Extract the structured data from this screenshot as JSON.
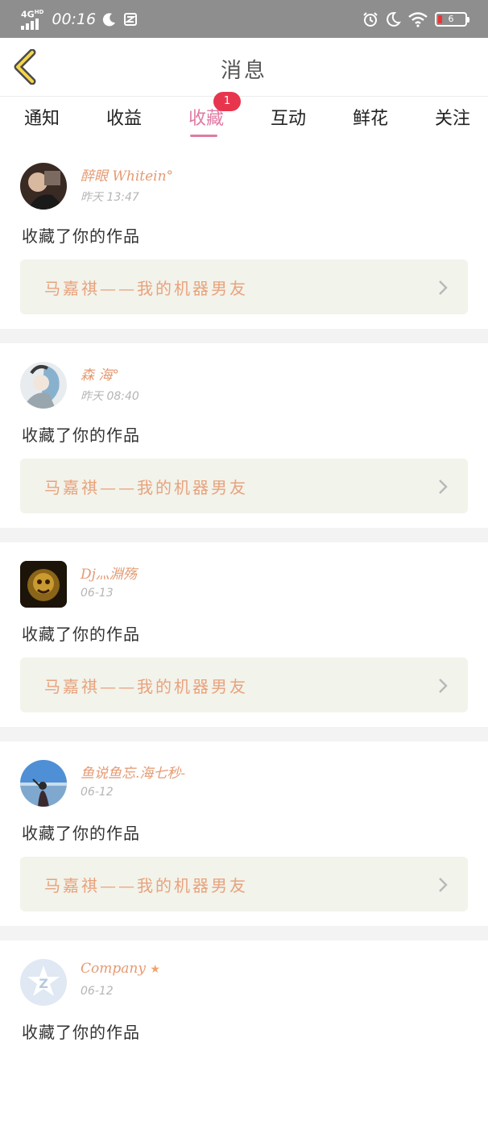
{
  "status_bar": {
    "network": "4G",
    "network_sup": "HD",
    "time": "00:16",
    "battery": "6"
  },
  "header": {
    "title": "消息"
  },
  "tabs": [
    {
      "label": "通知"
    },
    {
      "label": "收益"
    },
    {
      "label": "收藏",
      "badge": "1",
      "active": true
    },
    {
      "label": "互动"
    },
    {
      "label": "鲜花"
    },
    {
      "label": "关注"
    }
  ],
  "messages": [
    {
      "user": "醉眼 Whitein°",
      "time": "昨天 13:47",
      "action": "收藏了你的作品",
      "work": "马嘉祺——我的机器男友"
    },
    {
      "user": "森 海°",
      "time": "昨天 08:40",
      "action": "收藏了你的作品",
      "work": "马嘉祺——我的机器男友"
    },
    {
      "user": "Dj灬淵殇",
      "time": "06-13",
      "action": "收藏了你的作品",
      "work": "马嘉祺——我的机器男友"
    },
    {
      "user": "鱼说鱼忘.海七秒-",
      "time": "06-12",
      "action": "收藏了你的作品",
      "work": "马嘉祺——我的机器男友"
    },
    {
      "user": "Company",
      "time": "06-12",
      "action": "收藏了你的作品",
      "work": ""
    }
  ],
  "colors": {
    "accent": "#e07aa3",
    "badge": "#e8354e",
    "username": "#e59a73",
    "work_title": "#e8a27d",
    "work_bg": "#f2f3ea"
  }
}
